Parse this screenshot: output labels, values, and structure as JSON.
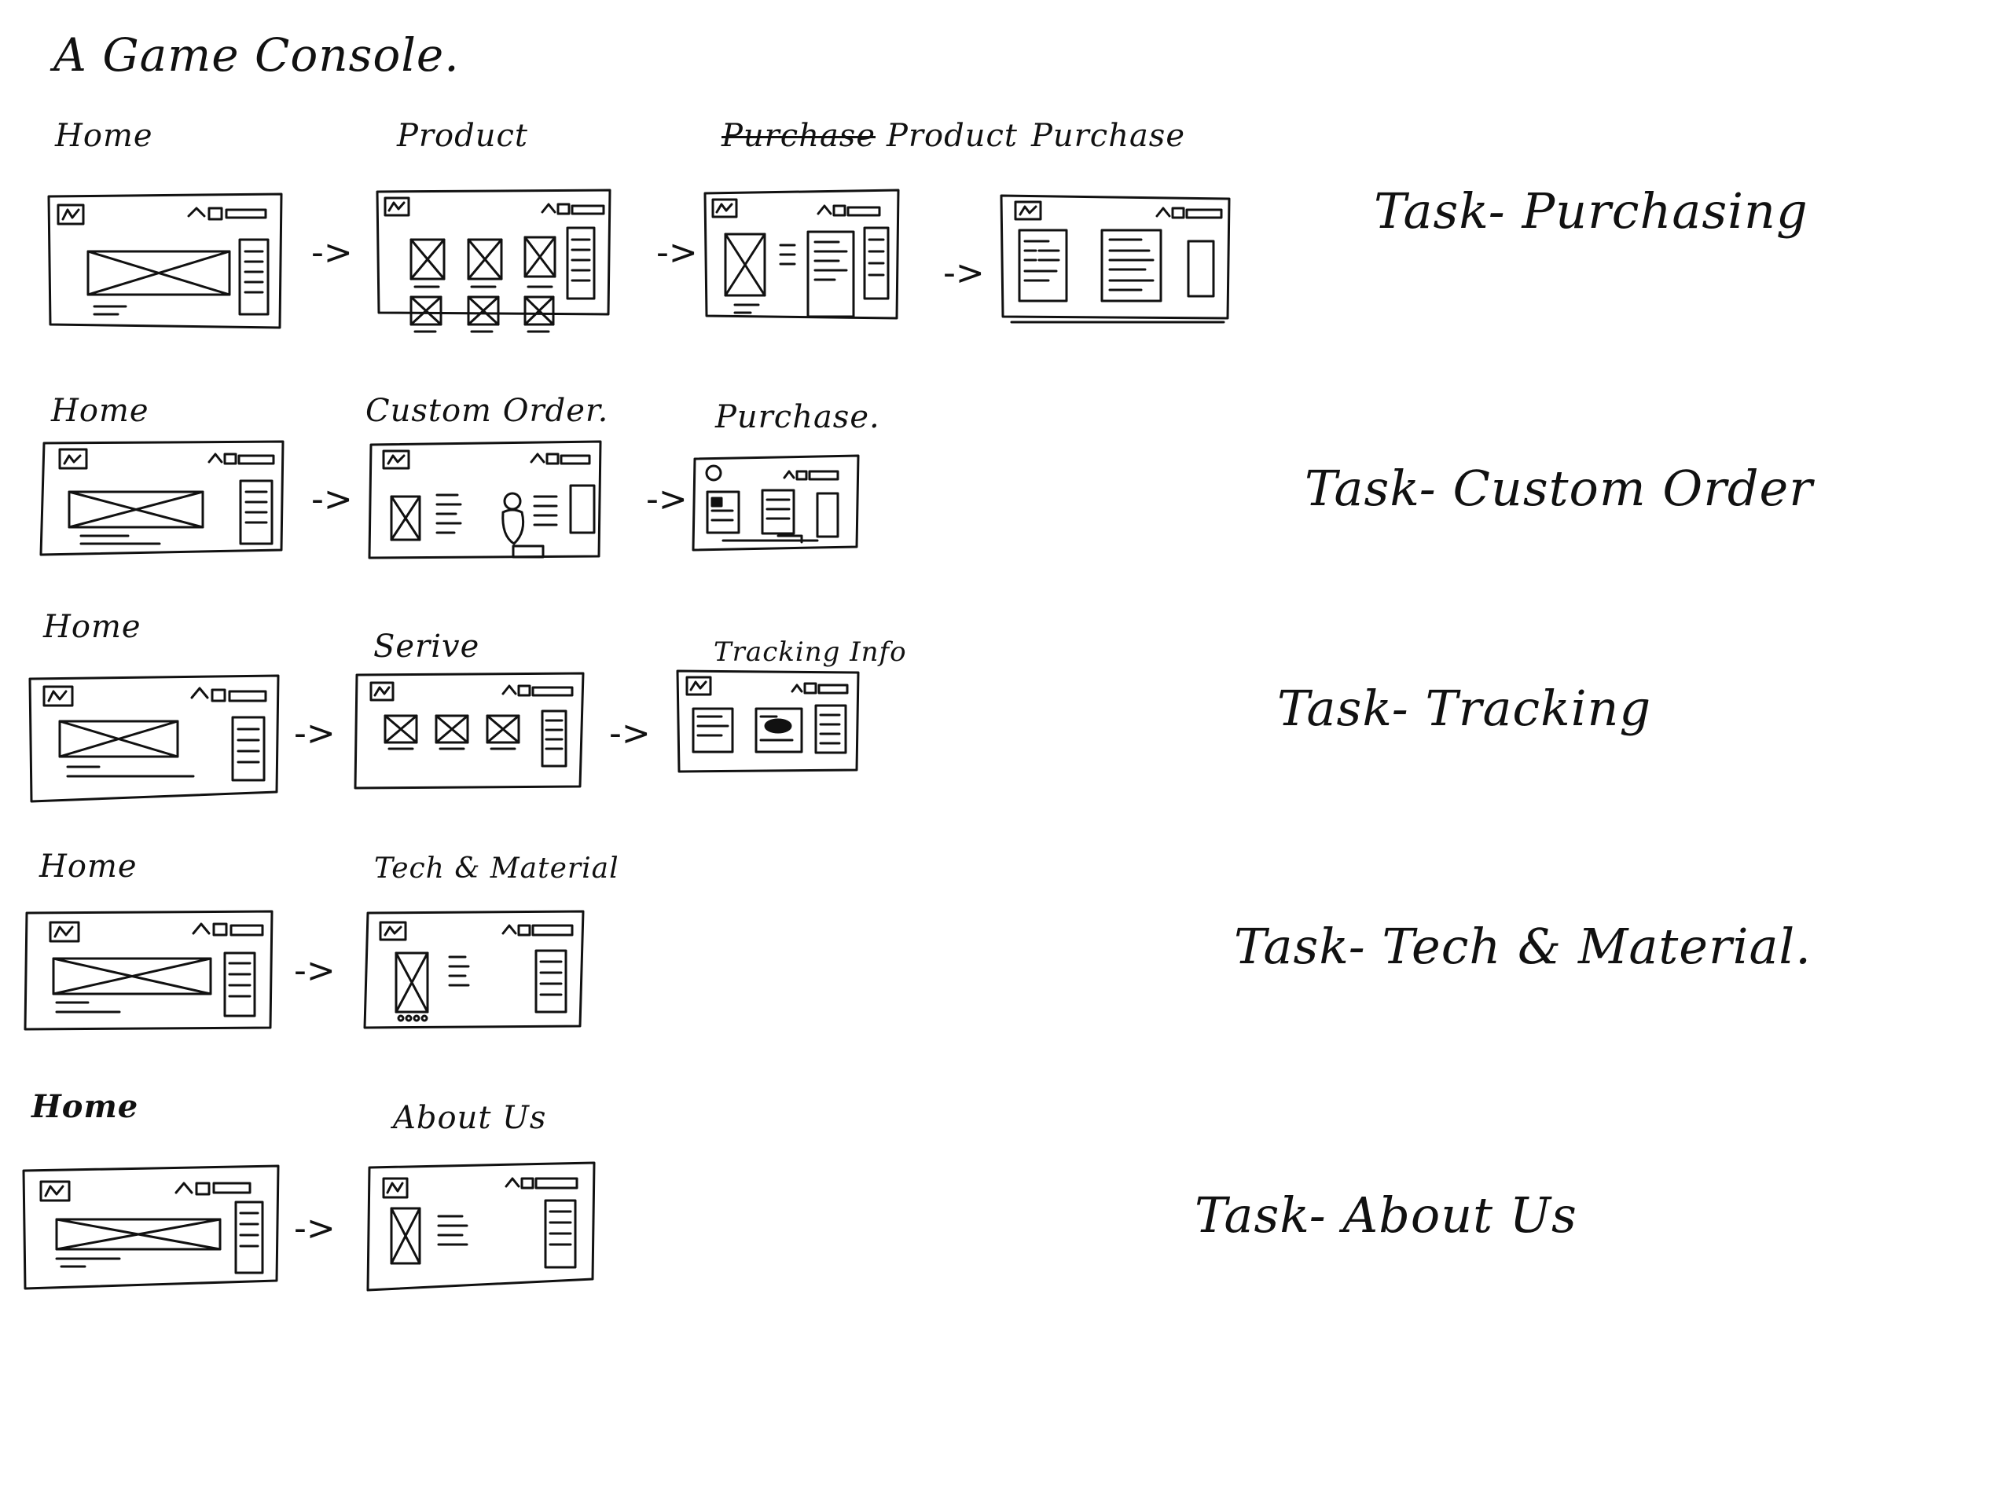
{
  "title": "A Game Console.",
  "flows": [
    {
      "screens": [
        {
          "label": "Home"
        },
        {
          "label": "Product"
        },
        {
          "label": "Product",
          "struck": "Purchase"
        },
        {
          "label": "Purchase"
        }
      ],
      "arrows": [
        "->",
        "->",
        "->"
      ],
      "task": "Task- Purchasing"
    },
    {
      "screens": [
        {
          "label": "Home"
        },
        {
          "label": "Custom Order."
        },
        {
          "label": "Purchase."
        }
      ],
      "arrows": [
        "->",
        "->"
      ],
      "task": "Task- Custom Order"
    },
    {
      "screens": [
        {
          "label": "Home"
        },
        {
          "label": "Serive"
        },
        {
          "label": "Tracking Info"
        }
      ],
      "arrows": [
        "->",
        "->"
      ],
      "task": "Task- Tracking"
    },
    {
      "screens": [
        {
          "label": "Home"
        },
        {
          "label": "Tech & Material"
        }
      ],
      "arrows": [
        "->"
      ],
      "task": "Task- Tech & Material."
    },
    {
      "screens": [
        {
          "label": "Home"
        },
        {
          "label": "About Us"
        }
      ],
      "arrows": [
        "->"
      ],
      "task": "Task- About Us"
    }
  ]
}
